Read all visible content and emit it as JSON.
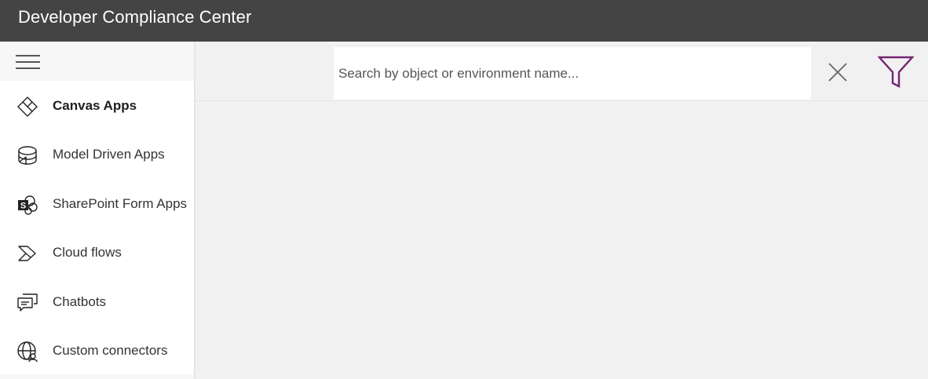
{
  "app": {
    "title": "Developer Compliance Center"
  },
  "sidebar": {
    "menu_icon": "hamburger-icon",
    "items": [
      {
        "label": "Canvas Apps",
        "icon": "canvas-apps-icon",
        "active": true
      },
      {
        "label": "Model Driven Apps",
        "icon": "model-driven-apps-icon",
        "active": false
      },
      {
        "label": "SharePoint Form Apps",
        "icon": "sharepoint-icon",
        "active": false
      },
      {
        "label": "Cloud flows",
        "icon": "cloud-flows-icon",
        "active": false
      },
      {
        "label": "Chatbots",
        "icon": "chatbot-icon",
        "active": false
      },
      {
        "label": "Custom connectors",
        "icon": "custom-connectors-icon",
        "active": false
      }
    ]
  },
  "search": {
    "placeholder": "Search by object or environment name...",
    "value": "",
    "clear_icon": "close-icon",
    "filter_icon": "filter-icon"
  },
  "colors": {
    "header_bg": "#444444",
    "accent_filter": "#742774",
    "content_bg": "#f1f1f1"
  }
}
